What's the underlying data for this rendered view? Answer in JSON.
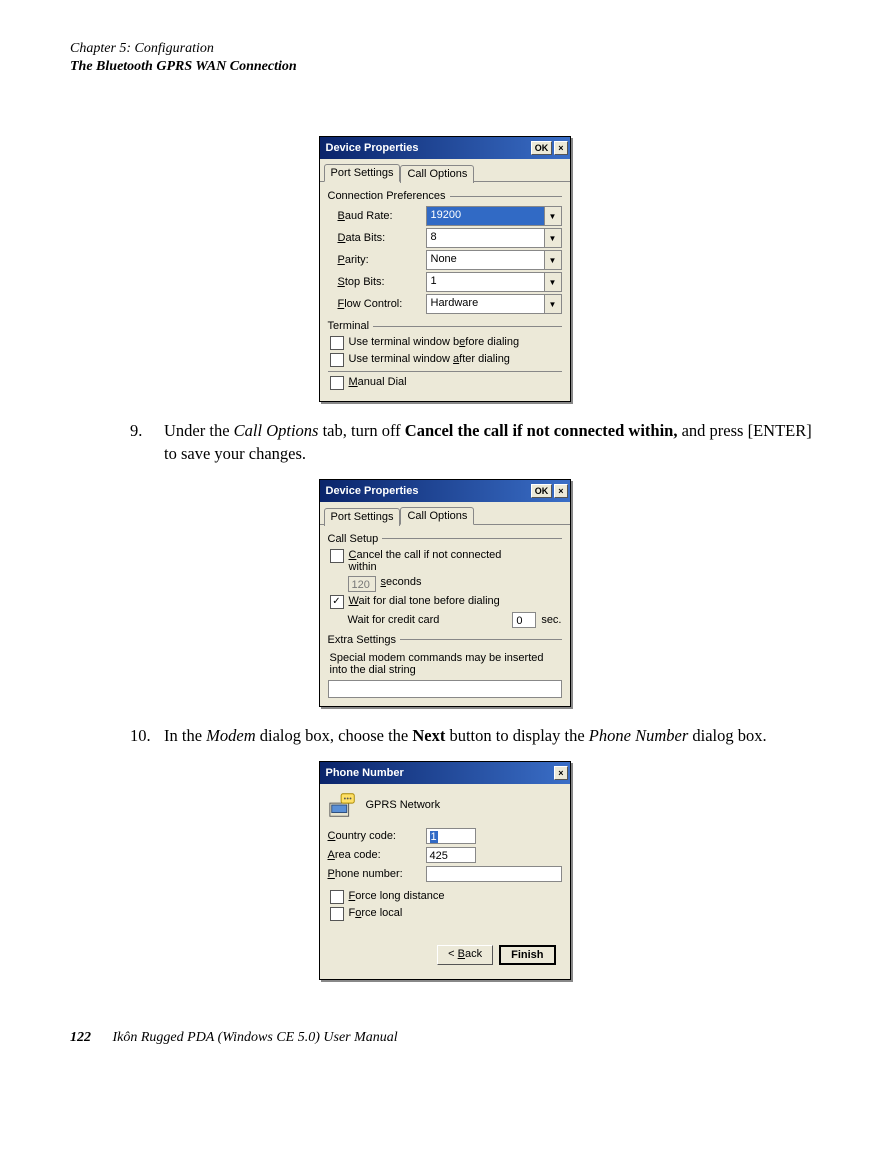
{
  "header": {
    "chapter": "Chapter 5:  Configuration",
    "section": "The Bluetooth GPRS WAN Connection"
  },
  "steps": {
    "s9": {
      "num": "9.",
      "pre": "Under the ",
      "italic1": "Call Options",
      "mid1": " tab, turn off ",
      "bold1": "Cancel the call if not connected within,",
      "mid2": " and press [ENTER] to save your changes."
    },
    "s10": {
      "num": "10.",
      "pre": "In the ",
      "italic1": "Modem",
      "mid1": " dialog box, choose the ",
      "bold1": "Next",
      "mid2": " button to display the ",
      "italic2": "Phone Number",
      "post": " dialog box."
    }
  },
  "dialog1": {
    "title": "Device Properties",
    "ok": "OK",
    "tab1": "Port Settings",
    "tab2": "Call Options",
    "group1": "Connection Preferences",
    "baud_label": "Baud Rate:",
    "baud_val": "19200",
    "data_label": "Data Bits:",
    "data_val": "8",
    "parity_label": "Parity:",
    "parity_val": "None",
    "stop_label": "Stop Bits:",
    "stop_val": "1",
    "flow_label": "Flow Control:",
    "flow_val": "Hardware",
    "group2": "Terminal",
    "chk1": "Use terminal window before dialing",
    "chk2": "Use terminal window after dialing",
    "chk3": "Manual Dial"
  },
  "dialog2": {
    "title": "Device Properties",
    "ok": "OK",
    "tab1": "Port Settings",
    "tab2": "Call Options",
    "group1": "Call Setup",
    "cancel_line1": "Cancel the call if not connected",
    "cancel_line2": "within",
    "sec_val": "120",
    "sec_label": "seconds",
    "wait_dial": "Wait for dial tone before dialing",
    "wait_cc": "Wait for credit card",
    "cc_val": "0",
    "cc_unit": "sec.",
    "group2": "Extra Settings",
    "extra_text": "Special modem commands may be inserted into the dial string"
  },
  "dialog3": {
    "title": "Phone Number",
    "subtitle": "GPRS Network",
    "country_label": "Country code:",
    "country_val": "1",
    "area_label": "Area code:",
    "area_val": "425",
    "phone_label": "Phone number:",
    "chk1": "Force long distance",
    "chk2": "Force local",
    "back": "< Back",
    "finish": "Finish"
  },
  "footer": {
    "page": "122",
    "title": "Ikôn Rugged PDA (Windows CE 5.0) User Manual"
  }
}
